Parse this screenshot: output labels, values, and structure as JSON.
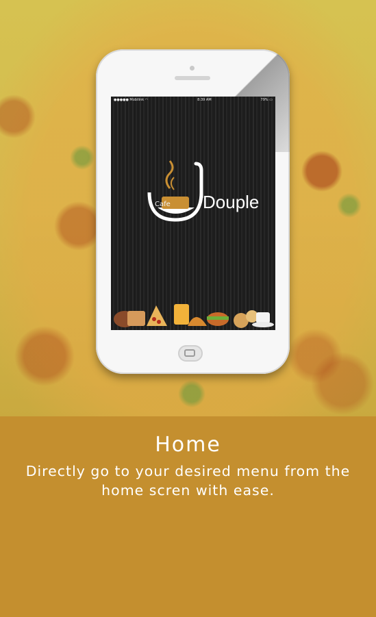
{
  "status_bar": {
    "carrier": "Mobilink",
    "time": "8:39 AM",
    "battery": "79%"
  },
  "logo": {
    "cafe_text": "Cafe",
    "brand_text": "Douple"
  },
  "info": {
    "title": "Home",
    "description": "Directly go to your desired menu from the home scren with ease."
  },
  "colors": {
    "panel": "#c48f2f",
    "logo_accent": "#c98f33",
    "screen_bg": "#1e1e1e"
  }
}
